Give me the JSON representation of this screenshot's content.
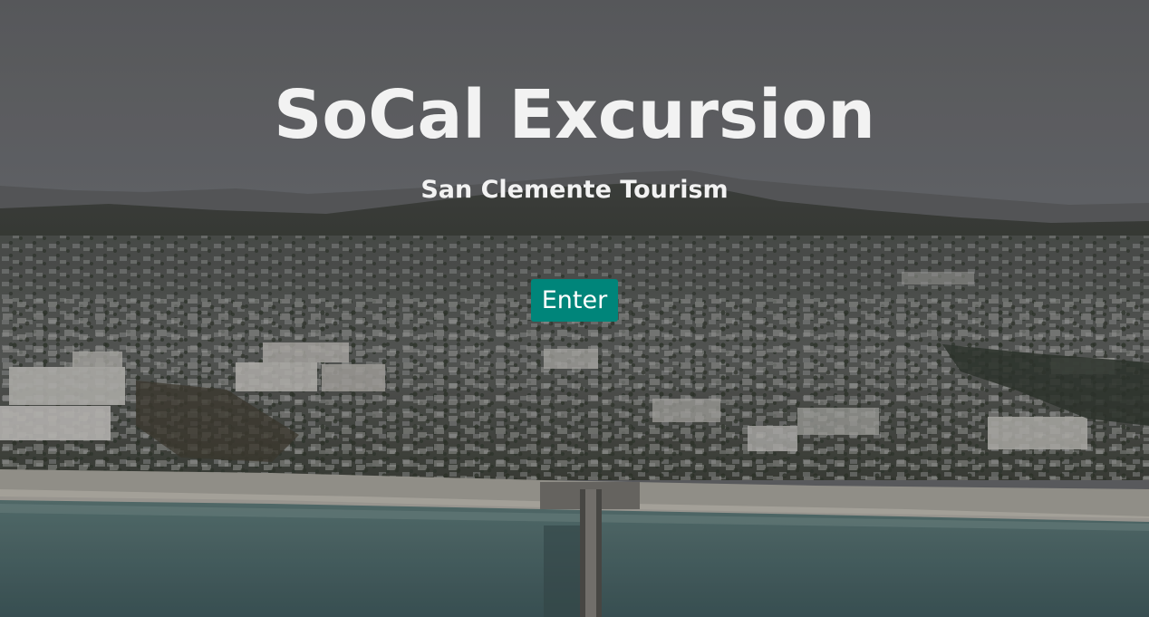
{
  "hero": {
    "title": "SoCal Excursion",
    "subtitle": "San Clemente Tourism",
    "enter_label": "Enter"
  },
  "colors": {
    "accent": "#00857a",
    "text": "#f2f2f2",
    "sky": "#5e5f62",
    "ocean": "#4a6466"
  },
  "background_image": "aerial-coastal-city-photo"
}
